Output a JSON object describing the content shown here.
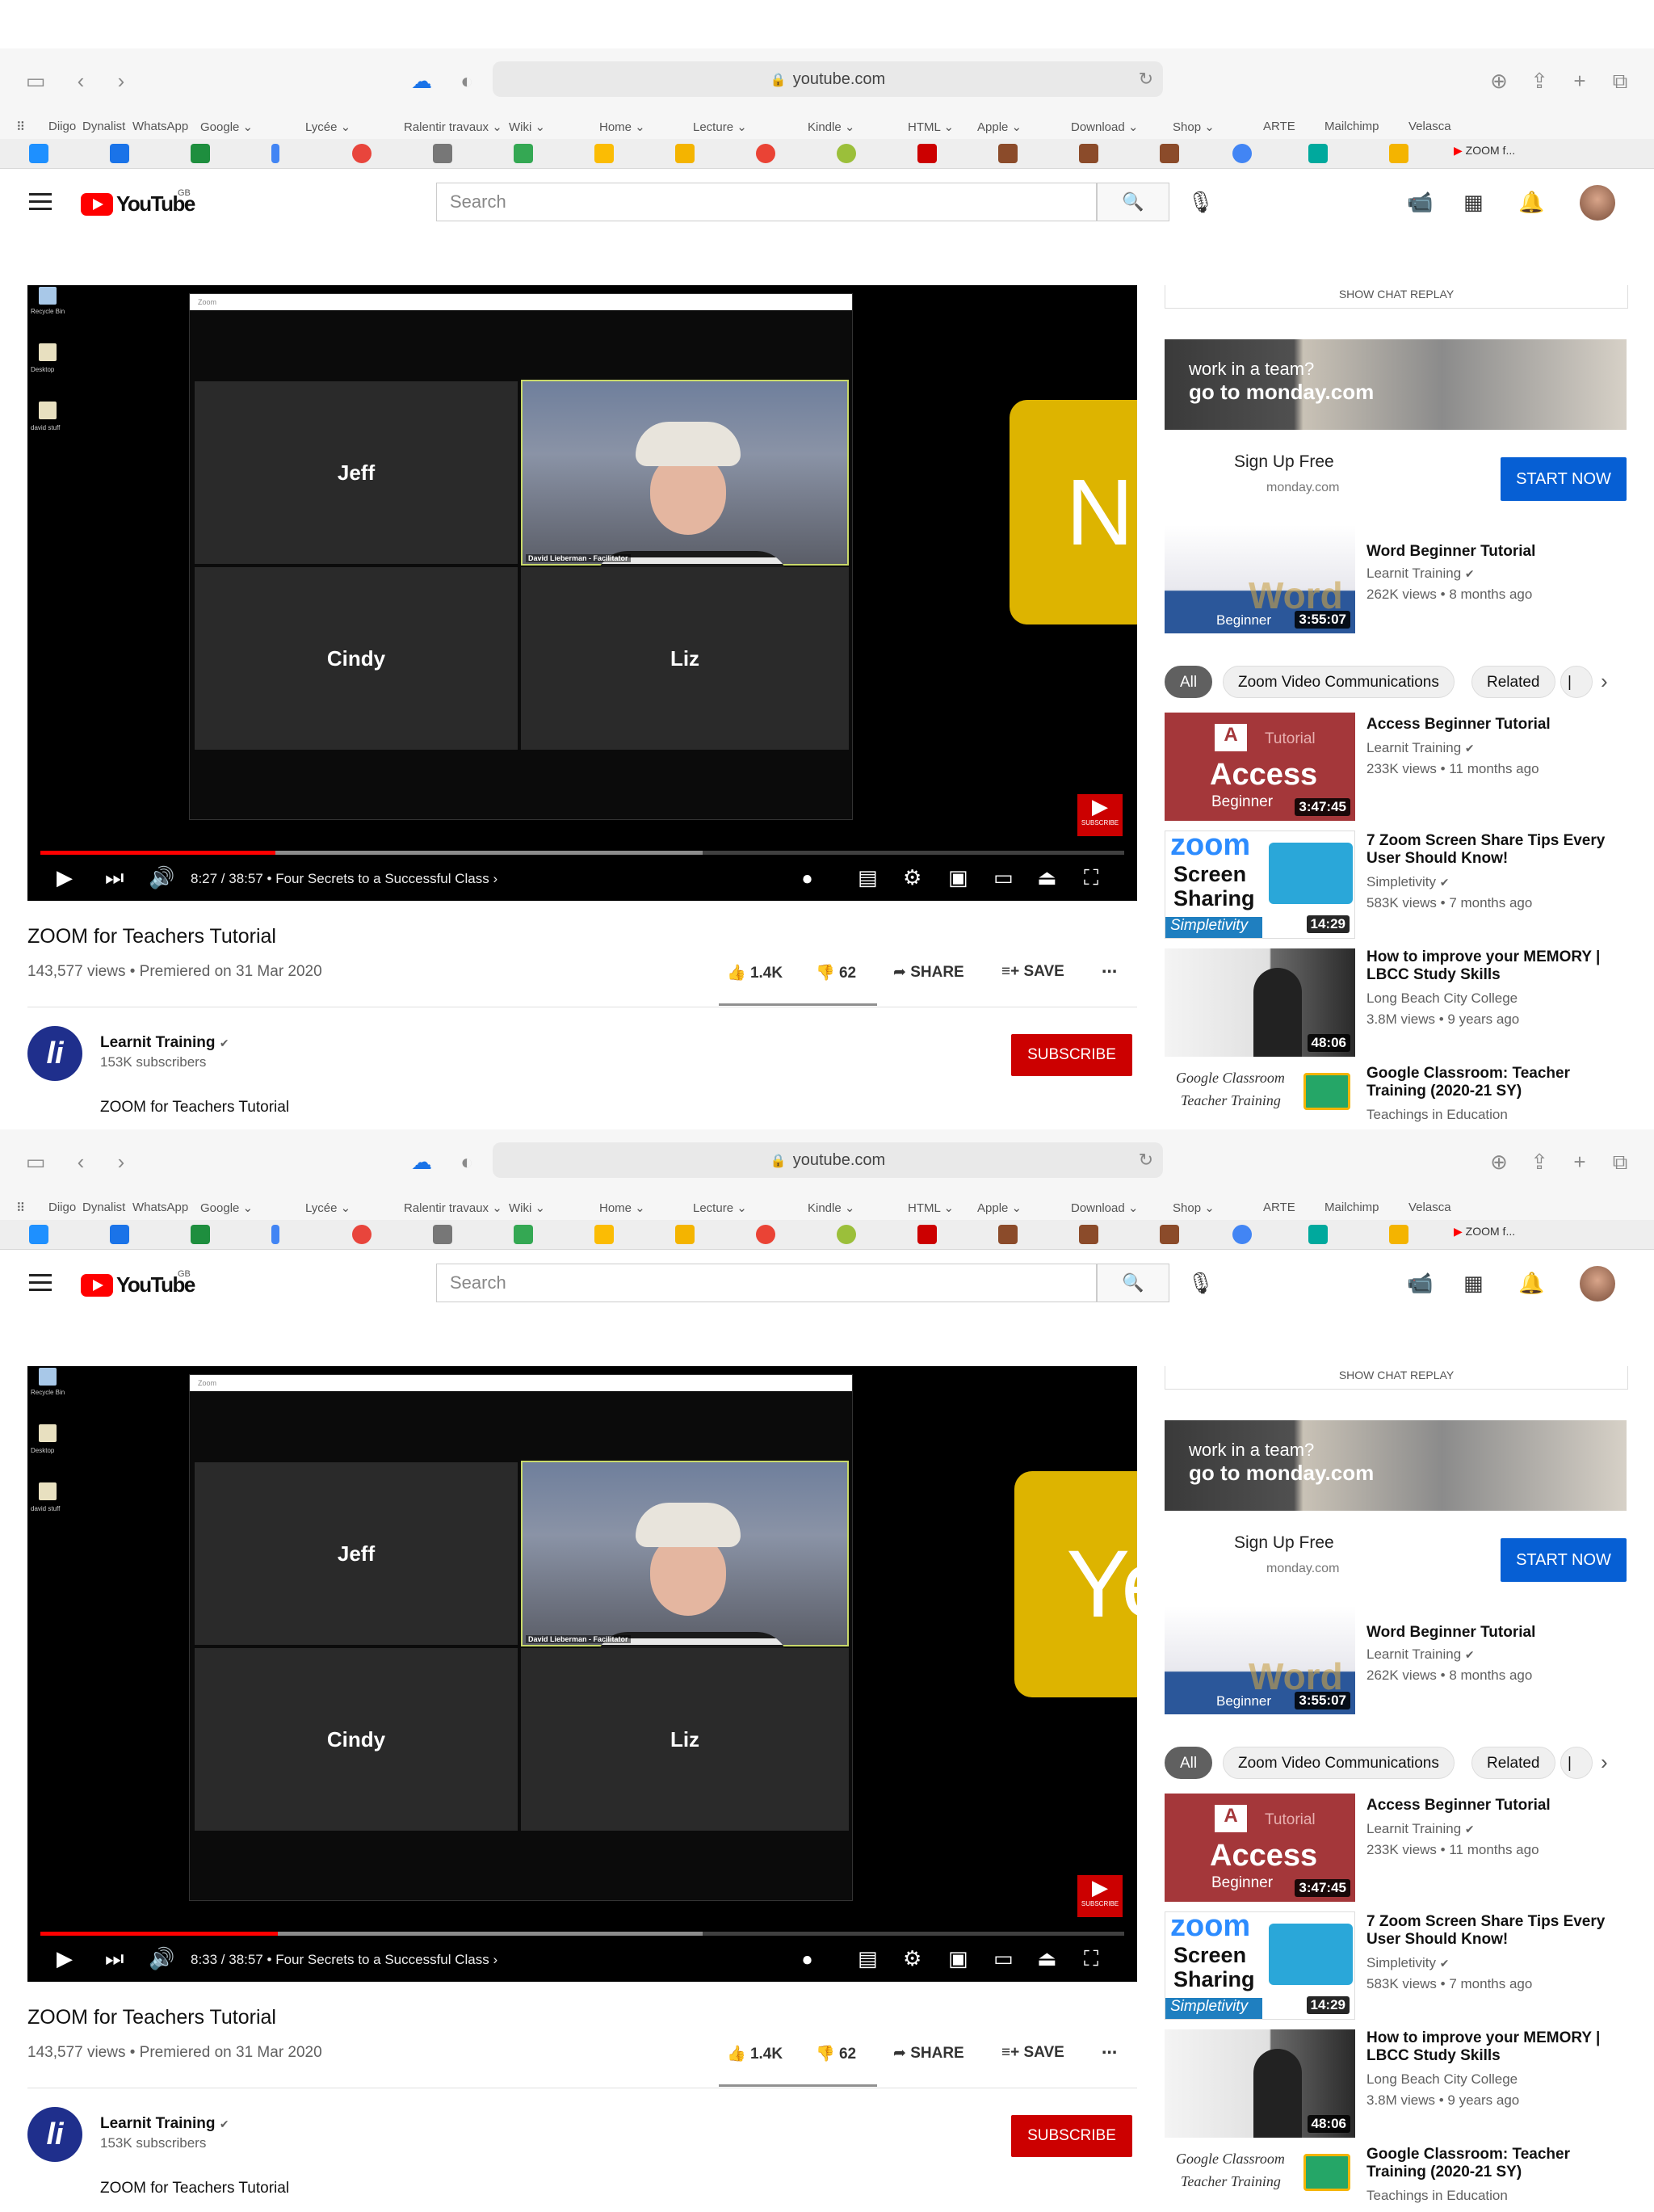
{
  "browser": {
    "url": "youtube.com",
    "bookmarks": [
      "Diigo",
      "Dynalist",
      "WhatsApp",
      "Google ⌄",
      "Lycée ⌄",
      "Ralentir travaux ⌄",
      "Wiki ⌄",
      "Home ⌄",
      "Lecture ⌄",
      "Kindle ⌄",
      "HTML ⌄",
      "Apple ⌄",
      "Download ⌄",
      "Shop ⌄",
      "ARTE",
      "Mailchimp",
      "Velasca"
    ],
    "active_tab": "ZOOM f..."
  },
  "youtube": {
    "logo": "YouTube",
    "region": "GB",
    "search_placeholder": "Search"
  },
  "video": {
    "participants": [
      "Jeff",
      "Cindy",
      "Liz"
    ],
    "facilitator_label": "David Lieberman - Facilitator",
    "chapter": "Four Secrets to a Successful Class",
    "title": "ZOOM for Teachers Tutorial",
    "meta": "143,577 views • Premiered on 31 Mar 2020",
    "likes": "1.4K",
    "dislikes": "62",
    "share": "SHARE",
    "save": "SAVE"
  },
  "panels": [
    {
      "time": "8:27 / 38:57",
      "overlay": "NO!",
      "played": 0.217
    },
    {
      "time": "8:33 / 38:57",
      "overlay": "Yes!",
      "played": 0.219
    }
  ],
  "channel": {
    "avatar_letter": "li",
    "name": "Learnit Training",
    "subscribers": "153K subscribers",
    "subscribe": "SUBSCRIBE",
    "description": "ZOOM for Teachers Tutorial"
  },
  "sidebar": {
    "chat_replay": "SHOW CHAT REPLAY",
    "ad": {
      "line1": "work in a team?",
      "line2": "go to monday.com",
      "cta": "Sign Up Free",
      "domain": "monday.com",
      "button": "START NOW"
    },
    "chips": [
      "All",
      "Zoom Video Communications",
      "Related"
    ],
    "videos": [
      {
        "title": "Word Beginner Tutorial",
        "channel": "Learnit Training",
        "stats": "262K views • 8 months ago",
        "duration": "3:55:07",
        "thumb_text": "Word",
        "thumb_sub": "Beginner"
      },
      {
        "title": "Access Beginner Tutorial",
        "channel": "Learnit Training",
        "stats": "233K views • 11 months ago",
        "duration": "3:47:45",
        "thumb_text": "Access",
        "thumb_sub": "Beginner"
      },
      {
        "title": "7 Zoom Screen Share Tips Every User Should Know!",
        "channel": "Simpletivity",
        "stats": "583K views • 7 months ago",
        "duration": "14:29",
        "thumb_text": "zoom",
        "thumb_sub": "Screen Sharing"
      },
      {
        "title": "How to improve your MEMORY | LBCC Study Skills",
        "channel": "Long Beach City College",
        "stats": "3.8M views • 9 years ago",
        "duration": "48:06",
        "thumb_text": "",
        "thumb_sub": ""
      },
      {
        "title": "Google Classroom: Teacher Training (2020-21 SY)",
        "channel": "Teachings in Education",
        "stats": "",
        "duration": "",
        "thumb_text": "Google Classroom",
        "thumb_sub": "Teacher Training"
      }
    ]
  },
  "colors": {
    "youtube_red": "#ff0000",
    "subscribe_red": "#cc0000",
    "start_blue": "#065fd4",
    "overlay_yellow": "#f5c800"
  }
}
